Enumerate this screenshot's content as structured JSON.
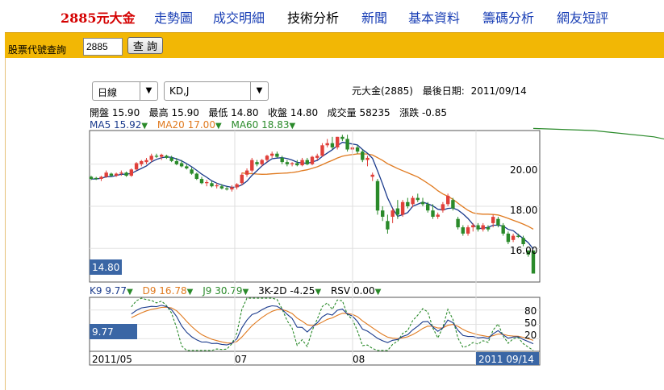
{
  "nav": {
    "brand": "2885元大金",
    "items": [
      "走勢圖",
      "成交明細",
      "技術分析",
      "新聞",
      "基本資料",
      "籌碼分析",
      "網友短評"
    ]
  },
  "query": {
    "label": "股票代號查詢",
    "value": "2885",
    "button": "查 詢"
  },
  "selects": {
    "period": "日線",
    "indicator": "KD,J"
  },
  "info": {
    "name": "元大金(2885)",
    "last_date_label": "最後日期:",
    "last_date": "2011/09/14"
  },
  "ohlc": {
    "open_label": "開盤",
    "open": "15.90",
    "high_label": "最高",
    "high": "15.90",
    "low_label": "最低",
    "low": "14.80",
    "close_label": "收盤",
    "close": "14.80",
    "volume_label": "成交量",
    "volume": "58235",
    "change_label": "漲跌",
    "change": "-0.85"
  },
  "ma": {
    "ma5_label": "MA5",
    "ma5": "15.92",
    "ma20_label": "MA20",
    "ma20": "17.00",
    "ma60_label": "MA60",
    "ma60": "18.83"
  },
  "kd": {
    "k9_label": "K9",
    "k9": "9.77",
    "d9_label": "D9",
    "d9": "16.78",
    "j9_label": "J9",
    "j9": "30.79",
    "k3d2_label": "3K-2D",
    "k3d2": "-4.25",
    "rsv_label": "RSV",
    "rsv": "0.00"
  },
  "price_axis": {
    "ticks": [
      "20.00",
      "18.00",
      "16.00"
    ],
    "current": "14.80"
  },
  "kd_axis": {
    "ticks": [
      "80",
      "50",
      "20"
    ],
    "current": "9.77"
  },
  "date_axis": {
    "labels": [
      "2011/05",
      "07",
      "08"
    ],
    "end": "2011 09/14"
  },
  "colors": {
    "up": "#e0403a",
    "down": "#2a8a2a",
    "ma5": "#1a3a8c",
    "ma20": "#e07a1f",
    "ma60": "#2a8a2a",
    "brand": "#d40000",
    "nav": "#1a3fb5",
    "bar": "#f2b705"
  },
  "chart_data": {
    "type": "candlestick",
    "price_ylim": [
      14.4,
      21.6
    ],
    "candles": [
      [
        19.4,
        19.45,
        19.25,
        19.3
      ],
      [
        19.35,
        19.4,
        19.25,
        19.3
      ],
      [
        19.3,
        19.45,
        19.2,
        19.4
      ],
      [
        19.4,
        19.7,
        19.35,
        19.6
      ],
      [
        19.55,
        19.6,
        19.4,
        19.45
      ],
      [
        19.45,
        19.6,
        19.4,
        19.55
      ],
      [
        19.55,
        19.7,
        19.45,
        19.6
      ],
      [
        19.6,
        19.65,
        19.4,
        19.45
      ],
      [
        19.45,
        19.8,
        19.4,
        19.75
      ],
      [
        19.75,
        20.1,
        19.7,
        20.05
      ],
      [
        20.0,
        20.2,
        19.9,
        20.15
      ],
      [
        20.1,
        20.3,
        20.0,
        20.2
      ],
      [
        20.2,
        20.5,
        20.1,
        20.4
      ],
      [
        20.4,
        20.5,
        20.3,
        20.35
      ],
      [
        20.35,
        20.5,
        20.2,
        20.45
      ],
      [
        20.4,
        20.45,
        20.25,
        20.3
      ],
      [
        20.3,
        20.4,
        20.1,
        20.15
      ],
      [
        20.15,
        20.3,
        19.95,
        20.0
      ],
      [
        20.05,
        20.2,
        19.85,
        19.9
      ],
      [
        19.9,
        20.0,
        19.75,
        19.8
      ],
      [
        19.75,
        19.85,
        19.5,
        19.55
      ],
      [
        19.55,
        19.6,
        19.25,
        19.3
      ],
      [
        19.3,
        19.4,
        19.05,
        19.1
      ],
      [
        19.1,
        19.25,
        18.95,
        19.15
      ],
      [
        19.1,
        19.2,
        18.9,
        18.95
      ],
      [
        18.95,
        19.1,
        18.85,
        19.0
      ],
      [
        18.95,
        19.05,
        18.8,
        18.85
      ],
      [
        18.85,
        18.95,
        18.75,
        18.8
      ],
      [
        18.8,
        19.0,
        18.7,
        18.9
      ],
      [
        18.9,
        19.1,
        18.8,
        19.05
      ],
      [
        19.1,
        19.6,
        19.0,
        19.5
      ],
      [
        19.5,
        19.8,
        19.4,
        19.7
      ],
      [
        19.7,
        20.3,
        19.6,
        20.2
      ],
      [
        20.1,
        20.2,
        19.9,
        20.0
      ],
      [
        20.0,
        20.25,
        19.9,
        20.2
      ],
      [
        20.2,
        20.45,
        20.1,
        20.4
      ],
      [
        20.4,
        20.6,
        20.3,
        20.5
      ],
      [
        20.5,
        20.6,
        20.3,
        20.35
      ],
      [
        20.3,
        20.4,
        20.0,
        20.1
      ],
      [
        20.1,
        20.2,
        19.9,
        20.0
      ],
      [
        20.0,
        20.1,
        19.9,
        20.05
      ],
      [
        20.05,
        20.2,
        19.9,
        19.95
      ],
      [
        19.95,
        20.3,
        19.9,
        20.2
      ],
      [
        20.2,
        20.3,
        19.95,
        20.0
      ],
      [
        20.0,
        20.4,
        19.95,
        20.35
      ],
      [
        20.3,
        20.5,
        20.2,
        20.4
      ],
      [
        20.4,
        21.0,
        20.35,
        20.9
      ],
      [
        20.9,
        21.2,
        20.8,
        21.0
      ],
      [
        21.0,
        21.3,
        20.7,
        20.8
      ],
      [
        20.8,
        21.3,
        20.7,
        21.3
      ],
      [
        21.3,
        21.4,
        21.1,
        21.2
      ],
      [
        21.2,
        21.4,
        20.6,
        20.7
      ],
      [
        20.7,
        20.9,
        20.5,
        20.8
      ],
      [
        20.8,
        20.9,
        20.5,
        20.6
      ],
      [
        20.6,
        20.7,
        20.1,
        20.2
      ],
      [
        20.2,
        20.4,
        19.9,
        20.3
      ],
      [
        19.4,
        19.6,
        19.2,
        19.5
      ],
      [
        19.2,
        19.3,
        17.6,
        17.8
      ],
      [
        17.8,
        18.0,
        17.3,
        17.5
      ],
      [
        17.3,
        17.6,
        16.7,
        16.9
      ],
      [
        17.5,
        17.9,
        17.2,
        17.8
      ],
      [
        17.9,
        18.3,
        17.4,
        17.6
      ],
      [
        17.6,
        18.3,
        17.5,
        18.2
      ],
      [
        18.2,
        18.4,
        17.9,
        18.0
      ],
      [
        18.1,
        18.5,
        17.95,
        18.4
      ],
      [
        18.4,
        18.6,
        18.2,
        18.3
      ],
      [
        18.2,
        18.4,
        18.0,
        18.1
      ],
      [
        18.1,
        18.2,
        17.7,
        17.8
      ],
      [
        17.8,
        18.1,
        17.4,
        17.5
      ],
      [
        17.5,
        17.7,
        17.4,
        17.6
      ],
      [
        17.8,
        18.2,
        17.7,
        18.1
      ],
      [
        18.1,
        18.6,
        18.0,
        18.5
      ],
      [
        18.3,
        18.4,
        17.8,
        17.9
      ],
      [
        17.4,
        17.5,
        16.9,
        17.0
      ],
      [
        17.0,
        17.1,
        16.6,
        16.7
      ],
      [
        16.7,
        17.1,
        16.6,
        17.0
      ],
      [
        17.0,
        17.2,
        16.8,
        17.1
      ],
      [
        17.1,
        17.2,
        16.8,
        16.9
      ],
      [
        16.9,
        17.2,
        16.8,
        17.1
      ],
      [
        17.0,
        17.1,
        16.8,
        16.9
      ],
      [
        17.2,
        17.6,
        17.0,
        17.5
      ],
      [
        17.4,
        17.5,
        17.0,
        17.1
      ],
      [
        17.1,
        17.2,
        16.6,
        16.7
      ],
      [
        16.7,
        16.8,
        16.2,
        16.3
      ],
      [
        16.4,
        16.7,
        16.3,
        16.6
      ],
      [
        16.6,
        16.7,
        16.5,
        16.55
      ],
      [
        16.5,
        16.6,
        16.1,
        16.2
      ],
      [
        15.9,
        15.9,
        15.6,
        15.7
      ],
      [
        15.9,
        15.9,
        14.8,
        14.8
      ]
    ],
    "ma60": [
      [
        88,
        21.7
      ],
      [
        100,
        21.6
      ],
      [
        112,
        21.3
      ],
      [
        126,
        20.6
      ],
      [
        155,
        20.3
      ],
      [
        190,
        19.9
      ],
      [
        213,
        19.5
      ],
      [
        234,
        18.83
      ]
    ],
    "kd_ylim": [
      0,
      100
    ]
  }
}
